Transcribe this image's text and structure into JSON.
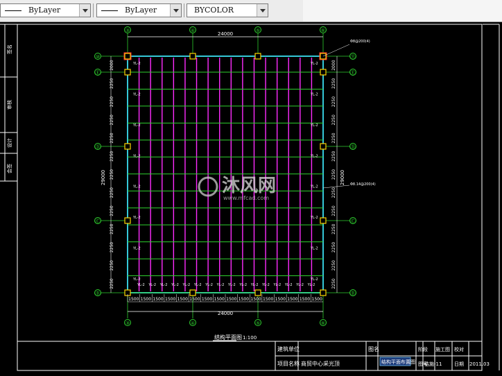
{
  "toolbar": {
    "linetype": "ByLayer",
    "lineweight": "ByLayer",
    "plotstyle": "BYCOLOR"
  },
  "drawing": {
    "column_axes_top": [
      "③",
      "④",
      "⑤",
      "⑥"
    ],
    "column_axes_bottom": [
      "③",
      "④",
      "⑤",
      "⑥"
    ],
    "row_axes_left": [
      "⑩",
      "Ⓔ",
      "Ⓓ",
      "Ⓒ",
      "Ⓑ"
    ],
    "row_axes_right": [
      "⑪",
      "Ⓔ",
      "Ⓓ",
      "Ⓒ",
      "Ⓑ"
    ],
    "overall_width": "24000",
    "overall_width_bottom": "24000",
    "overall_depth_left": "29000",
    "overall_depth_right": "29000",
    "bay_dims_left": [
      "2000",
      "2250",
      "2250",
      "2250",
      "2250",
      "2250",
      "2250",
      "2250",
      "2250",
      "2250",
      "2250",
      "2250",
      "2250"
    ],
    "bay_dims_right": [
      "2000",
      "2250",
      "2250",
      "2250",
      "2250",
      "2250",
      "2250",
      "2250",
      "2250",
      "2250",
      "2250",
      "2250",
      "2250"
    ],
    "purlin_dims": [
      "1500",
      "1500",
      "1500",
      "1500",
      "1500",
      "1500",
      "1500",
      "1500",
      "1500",
      "1500",
      "1500",
      "1500",
      "1500",
      "1500",
      "1500",
      "1500"
    ],
    "beam_tags": [
      "YL-2",
      "YL-2",
      "YL-2",
      "YL-2",
      "YL-2",
      "YL-2",
      "YL-2",
      "YL-2",
      "YL-2",
      "YL-2",
      "YL-2",
      "YL-2",
      "YL-2",
      "YL-2",
      "YL-2",
      "YL-2"
    ],
    "side_tags": [
      "YL-2",
      "YL-2",
      "YL-2",
      "YL-2",
      "YL-2",
      "YL-2",
      "YL-2",
      "YL-2",
      "YL-2",
      "YL-2",
      "YL-2",
      "YL-2",
      "YL-2",
      "YL-2",
      "YL-2",
      "YL-2"
    ],
    "callout_top": "Φ8@200(4)",
    "callout_mid": "Φ8.14@200(4)",
    "plan_title": "结构平面图",
    "plan_scale": "1:100",
    "watermark_text": "沐风网",
    "watermark_url": "www.mfcad.com"
  },
  "title_block": {
    "design_unit": "建筑单位",
    "project_name": "项目名称",
    "project_value": "商贸中心采光顶",
    "drawing_label": "图名",
    "drawing_name": "结构平面布置图",
    "stage": "施工图",
    "drawing_no": "结施-11",
    "date": "2011.03",
    "check_label": "校对",
    "number_label": "图号",
    "category_label": "阶段",
    "date_label": "日期"
  },
  "left_strip": [
    "签名",
    "审核",
    "设计",
    "会签"
  ]
}
